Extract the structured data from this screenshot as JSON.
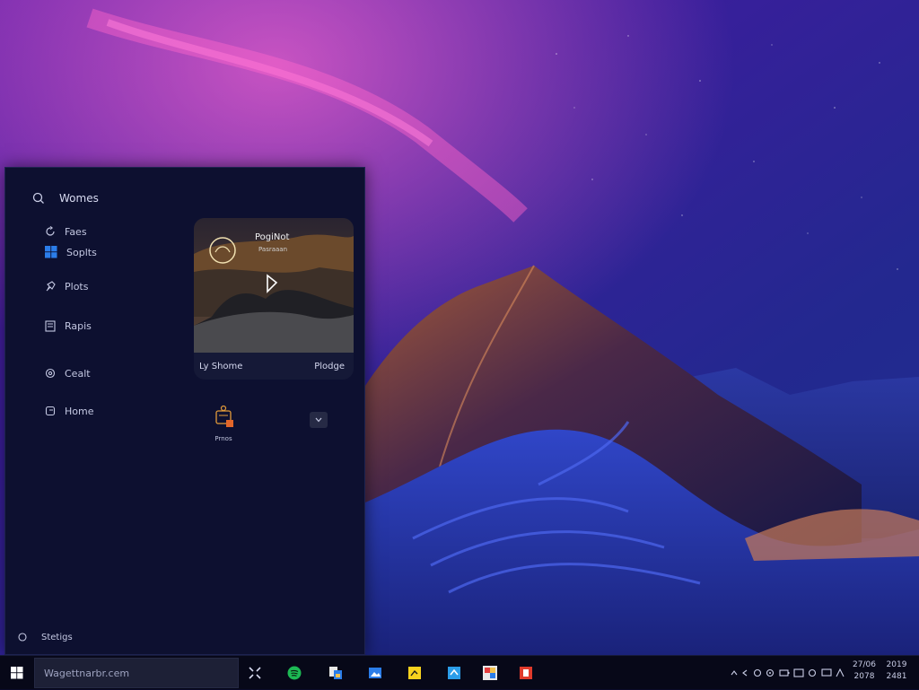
{
  "start_menu": {
    "header": {
      "label": "Womes"
    },
    "nav_items": [
      {
        "label": "Faes",
        "icon": "refresh-icon"
      },
      {
        "label": "Soplts",
        "icon": "windows-logo-icon"
      },
      {
        "label": "Plots",
        "icon": "pin-icon"
      },
      {
        "label": "Rapis",
        "icon": "document-icon"
      },
      {
        "label": "Cealt",
        "icon": "gear-icon"
      },
      {
        "label": "Home",
        "icon": "home-icon"
      }
    ],
    "featured": {
      "title": "PogiNot",
      "subtitle": "Pasraaan",
      "footer_left": "Ly Shome",
      "footer_right": "Plodge"
    },
    "small_app": {
      "label": "Prnos"
    },
    "settings": {
      "label": "Stetigs"
    }
  },
  "taskbar": {
    "search_text": "Wagettnarbr.cem",
    "pinned_icons": [
      "task-view-icon",
      "spotify-icon",
      "files-icon",
      "photos-icon",
      "sticky-notes-icon",
      "store-icon",
      "media-icon",
      "office-icon"
    ],
    "clock": {
      "left_top": "27/06",
      "left_bottom": "2078",
      "right_top": "2019",
      "right_bottom": "2481"
    }
  },
  "colors": {
    "panel_bg": "#0d1030",
    "taskbar_bg": "#070818",
    "accent_blue": "#2b7de9",
    "accent_orange": "#e39b3a"
  }
}
